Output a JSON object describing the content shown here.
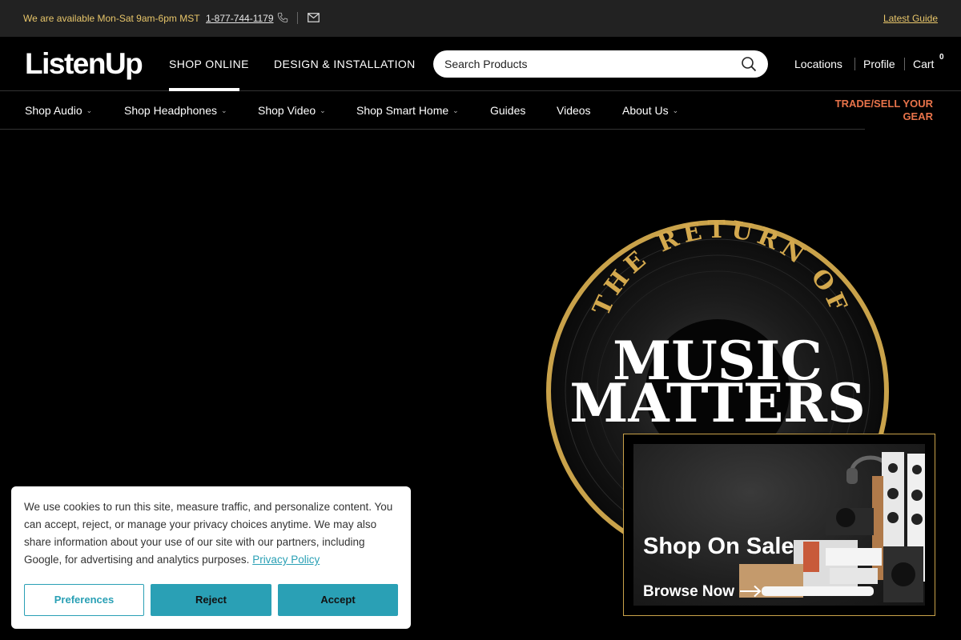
{
  "topbar": {
    "availability": "We are available Mon-Sat 9am-6pm MST",
    "phone": "1-877-744-1179",
    "latest_guide": "Latest Guide"
  },
  "header": {
    "logo": "ListenUp",
    "nav": [
      {
        "label": "SHOP ONLINE",
        "active": true
      },
      {
        "label": "DESIGN & INSTALLATION",
        "active": false
      }
    ],
    "search_placeholder": "Search Products",
    "links": [
      "Locations",
      "Profile",
      "Cart"
    ],
    "cart_count": "0"
  },
  "catnav": {
    "items": [
      {
        "label": "Shop Audio",
        "dropdown": true
      },
      {
        "label": "Shop Headphones",
        "dropdown": true
      },
      {
        "label": "Shop Video",
        "dropdown": true
      },
      {
        "label": "Shop Smart Home",
        "dropdown": true
      },
      {
        "label": "Guides",
        "dropdown": false
      },
      {
        "label": "Videos",
        "dropdown": false
      },
      {
        "label": "About Us",
        "dropdown": true
      }
    ],
    "trade": "TRADE/SELL YOUR GEAR"
  },
  "hero": {
    "arc_text": "THE RETURN OF",
    "line1": "MUSIC",
    "line2": "MATTERS"
  },
  "sale_card": {
    "title": "Shop On Sale",
    "browse": "Browse Now"
  },
  "cookie": {
    "text": "We use cookies to run this site, measure traffic, and personalize content. You can accept, reject, or manage your privacy choices anytime. We may also share information about your use of our site with our partners, including Google, for advertising and analytics purposes.",
    "policy_link": "Privacy Policy",
    "buttons": {
      "preferences": "Preferences",
      "reject": "Reject",
      "accept": "Accept"
    }
  },
  "colors": {
    "topbar_bg": "#222222",
    "gold_text": "#e8c66a",
    "trade_orange": "#e8734a",
    "cookie_teal": "#2aa0b5",
    "record_gold": "#c9a24a"
  }
}
